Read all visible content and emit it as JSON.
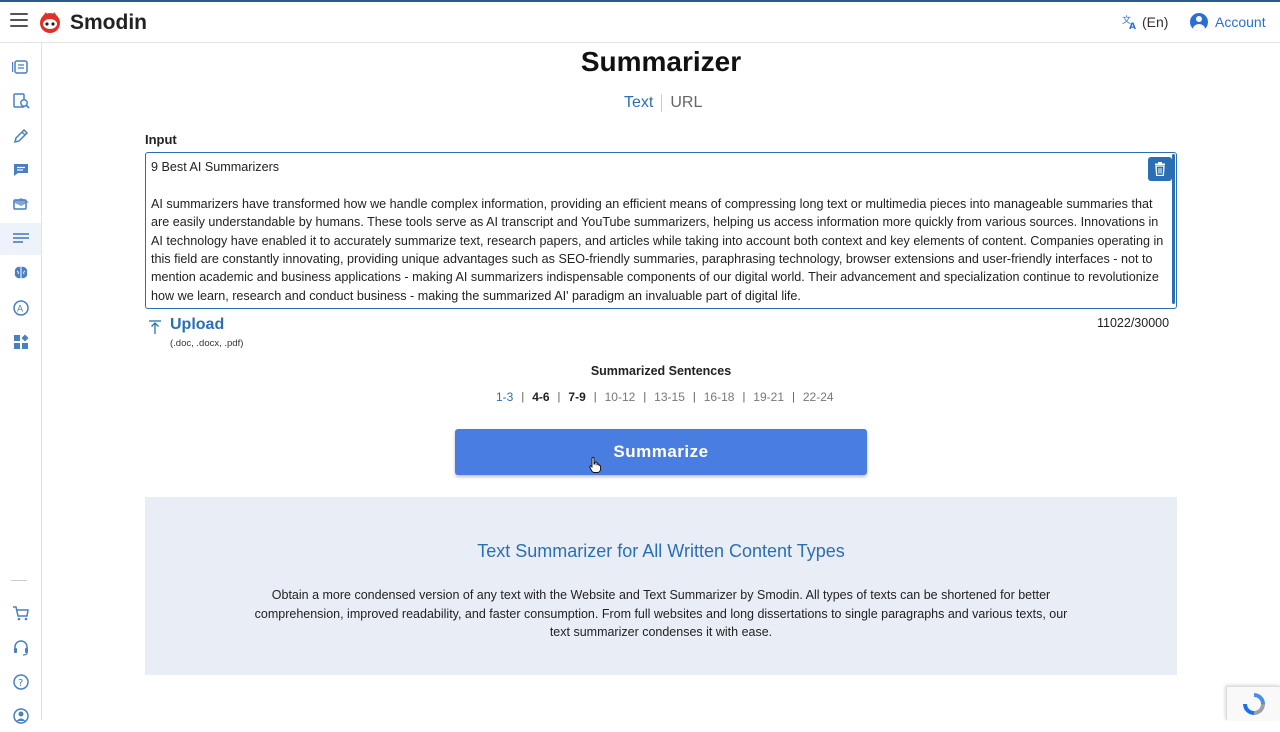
{
  "header": {
    "brand": "Smodin",
    "language": "(En)",
    "account": "Account",
    "accent_color": "#2a6fb4"
  },
  "sidebar": {
    "items": [
      {
        "icon": "document-scan-icon"
      },
      {
        "icon": "plagiarism-search-icon"
      },
      {
        "icon": "pen-icon"
      },
      {
        "icon": "chat-icon"
      },
      {
        "icon": "graduation-cap-icon"
      },
      {
        "icon": "summarizer-lines-icon",
        "active": true
      },
      {
        "icon": "brain-icon"
      },
      {
        "icon": "ai-detector-icon"
      },
      {
        "icon": "apps-icon"
      },
      {
        "icon": "cart-icon"
      },
      {
        "icon": "headset-icon"
      },
      {
        "icon": "help-icon"
      },
      {
        "icon": "user-icon"
      }
    ]
  },
  "main": {
    "title": "Summarizer",
    "tabs": [
      {
        "label": "Text",
        "active": true
      },
      {
        "label": "URL",
        "active": false
      }
    ],
    "input_label": "Input",
    "input_text": {
      "title_line": "9 Best AI Summarizers",
      "paragraph": "AI summarizers have transformed how we handle complex information, providing an efficient means of compressing long text or multimedia pieces into manageable summaries that are easily understandable by humans. These tools serve as AI transcript and YouTube summarizers, helping us access information more quickly from various sources. Innovations in AI technology have enabled it to accurately summarize text, research papers, and articles while taking into account both context and key elements of content. Companies operating in this field are constantly innovating, providing unique advantages such as SEO-friendly summaries, paraphrasing technology, browser extensions and user-friendly interfaces - not to mention academic and business applications - making AI summarizers indispensable components of our digital world. Their advancement and specialization continue to revolutionize how we learn, research and conduct business - making the summarized AI' paradigm an invaluable part of digital life."
    },
    "upload": {
      "label": "Upload",
      "formats": "(.doc, .docx, .pdf)"
    },
    "char_count": "11022/30000",
    "summarized_label": "Summarized Sentences",
    "ranges": [
      {
        "label": "1-3",
        "state": "selected"
      },
      {
        "label": "4-6",
        "state": "dark"
      },
      {
        "label": "7-9",
        "state": "dark"
      },
      {
        "label": "10-12",
        "state": "normal"
      },
      {
        "label": "13-15",
        "state": "normal"
      },
      {
        "label": "16-18",
        "state": "normal"
      },
      {
        "label": "19-21",
        "state": "normal"
      },
      {
        "label": "22-24",
        "state": "normal"
      }
    ],
    "summarize_button": "Summarize"
  },
  "info": {
    "title": "Text Summarizer for All Written Content Types",
    "text": "Obtain a more condensed version of any text with the Website and Text Summarizer by Smodin. All types of texts can be shortened for better comprehension, improved readability, and faster consumption. From full websites and long dissertations to single paragraphs and various texts, our text summarizer condenses it with ease."
  }
}
